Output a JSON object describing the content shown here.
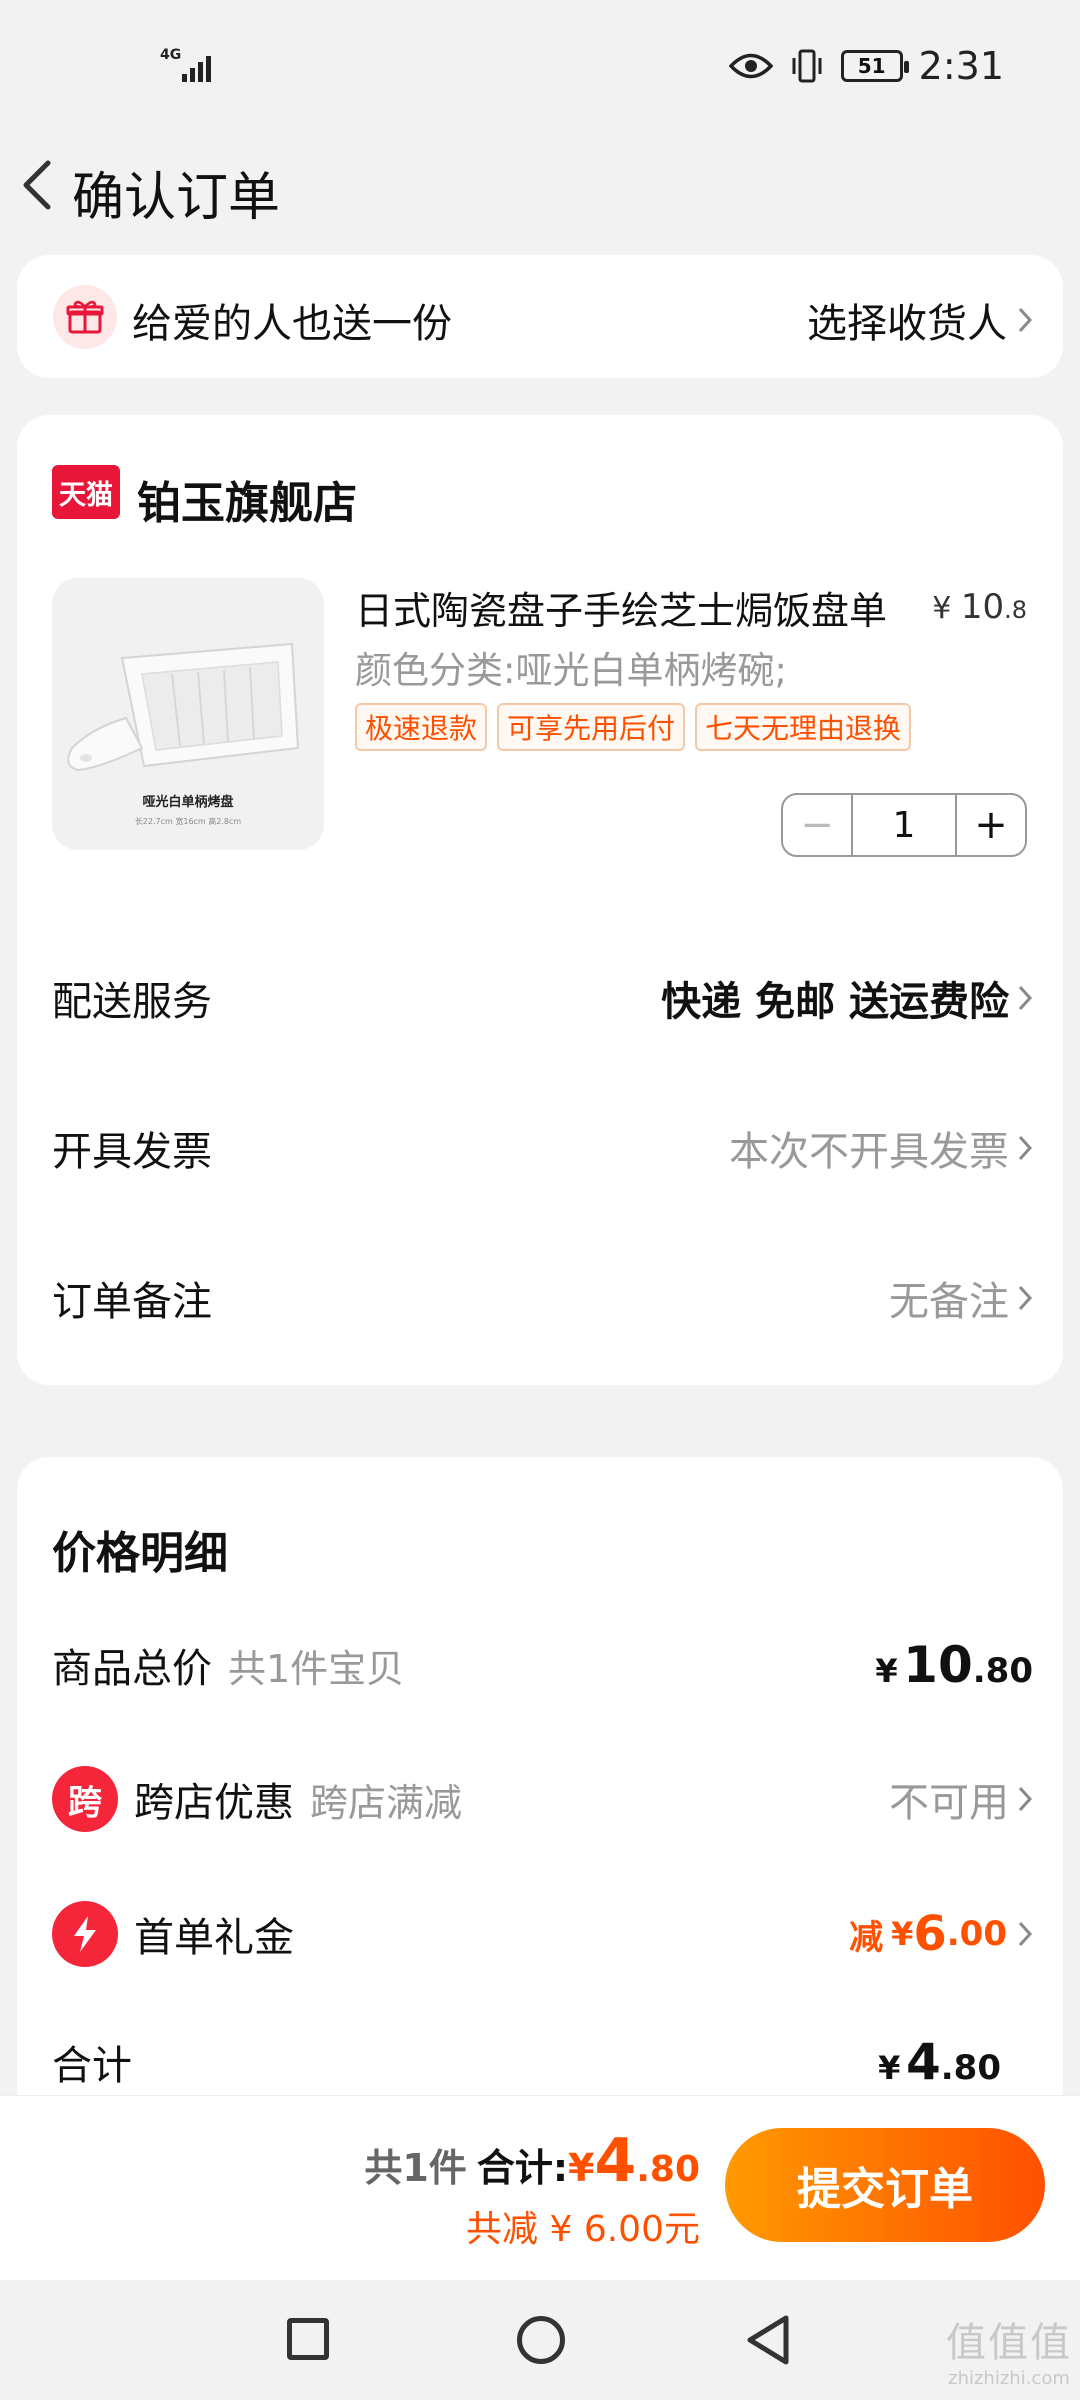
{
  "status_bar": {
    "network": "4G",
    "battery": "51",
    "time": "2:31"
  },
  "nav": {
    "title": "确认订单"
  },
  "gift": {
    "text": "给爱的人也送一份",
    "action": "选择收货人"
  },
  "shop": {
    "logo_text": "天猫",
    "name": "铂玉旗舰店"
  },
  "product": {
    "title": "日式陶瓷盘子手绘芝士焗饭盘单",
    "price_currency": "¥",
    "price_int": "10",
    "price_dec": ".8",
    "variant": "颜色分类:哑光白单柄烤碗;",
    "tags": [
      "极速退款",
      "可享先用后付",
      "七天无理由退换"
    ],
    "thumb_caption": "哑光白单柄烤盘",
    "thumb_dims": "长22.7cm 宽16cm 高2.8cm",
    "quantity": "1",
    "minus": "−",
    "plus": "+"
  },
  "rows": {
    "delivery": {
      "label": "配送服务",
      "value": "快递 免邮 送运费险"
    },
    "invoice": {
      "label": "开具发票",
      "value": "本次不开具发票"
    },
    "remark": {
      "label": "订单备注",
      "value": "无备注"
    }
  },
  "price_detail": {
    "title": "价格明细",
    "goods_total": {
      "label": "商品总价",
      "sub": "共1件宝贝",
      "currency": "¥",
      "int": "10",
      "dec": ".80"
    },
    "cross_store": {
      "icon_text": "跨",
      "label": "跨店优惠",
      "sub": "跨店满减",
      "value": "不可用"
    },
    "first_order": {
      "label": "首单礼金",
      "prefix": "减",
      "currency": "¥",
      "int": "6",
      "dec": ".00"
    },
    "total": {
      "label": "合计",
      "currency": "¥",
      "int": "4",
      "dec": ".80"
    }
  },
  "bottom": {
    "count": "共1件",
    "total_label": "合计:",
    "currency": "¥",
    "total_int": "4",
    "total_dec": ".80",
    "saved": "共减 ¥ 6.00元",
    "submit": "提交订单"
  },
  "watermark": {
    "top": "值值值",
    "bottom": "zhizhizhi.com"
  },
  "colors": {
    "accent": "#ff5000",
    "tmall_red": "#e8173a",
    "background": "#f2f2f2"
  }
}
